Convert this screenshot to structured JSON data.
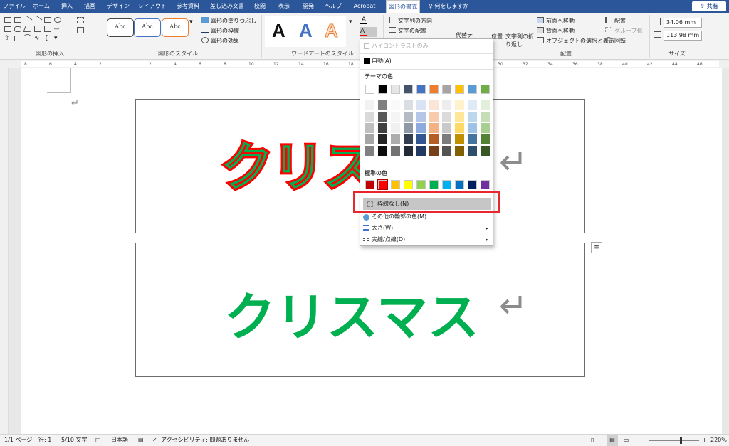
{
  "tabs": [
    "ファイル",
    "ホーム",
    "挿入",
    "描画",
    "デザイン",
    "レイアウト",
    "参考資料",
    "差し込み文書",
    "校閲",
    "表示",
    "開発",
    "ヘルプ",
    "Acrobat",
    "図形の書式",
    "何をしますか"
  ],
  "share_label": "共有",
  "groups": {
    "insert_shapes": "図形の挿入",
    "shape_styles": "図形のスタイル",
    "wordart_styles": "ワードアートのスタイル",
    "arrange": "配置",
    "size": "サイズ"
  },
  "shape_style_samples": [
    "Abc",
    "Abc",
    "Abc"
  ],
  "shape_fill": "図形の塗りつぶし",
  "shape_outline": "図形の枠線",
  "shape_effects": "図形の効果",
  "wordart_samples": [
    "A",
    "A",
    "A"
  ],
  "text_direction": "文字列の方向",
  "text_align": "文字の配置",
  "alt_text": "代替テ",
  "position": "位置",
  "wrap_text": "文字列の折り返し",
  "bring_forward": "前面へ移動",
  "send_backward": "背面へ移動",
  "selection_pane": "オブジェクトの選択と表示",
  "align": "配置",
  "group": "グループ化",
  "rotate": "回転",
  "height_value": "34.06 mm",
  "width_value": "113.98 mm",
  "ruler_numbers": [
    "8",
    "6",
    "4",
    "2",
    "",
    "2",
    "4",
    "6",
    "8",
    "10",
    "12",
    "14",
    "16",
    "18",
    "20",
    "22",
    "24",
    "26",
    "28",
    "30",
    "32",
    "34",
    "36",
    "38",
    "40",
    "42",
    "44",
    "46"
  ],
  "doc": {
    "text1": "クリスマス",
    "text2": "クリスマス"
  },
  "dropdown": {
    "high_contrast": "ハイコントラストのみ",
    "auto": "自動(A)",
    "theme_colors": "テーマの色",
    "standard_colors": "標準の色",
    "no_outline": "枠線なし(N)",
    "more_colors": "その他の輪郭の色(M)...",
    "weight": "太さ(W)",
    "dashes": "実線/点線(D)",
    "theme_swatches": [
      "#ffffff",
      "#000000",
      "#e7e6e6",
      "#44546a",
      "#4472c4",
      "#ed7d31",
      "#a5a5a5",
      "#ffc000",
      "#5b9bd5",
      "#70ad47"
    ],
    "standard_swatches": [
      "#c00000",
      "#ff0000",
      "#ffc000",
      "#ffff00",
      "#92d050",
      "#00b050",
      "#00b0f0",
      "#0070c0",
      "#002060",
      "#7030a0"
    ]
  },
  "status": {
    "page": "1/1 ページ",
    "line": "行: 1",
    "words": "5/10 文字",
    "lang": "日本語",
    "accessibility": "アクセシビリティ: 問題ありません",
    "zoom": "220%"
  },
  "colors": {
    "accent": "#2b579a",
    "red": "#ff0000",
    "green": "#00b050",
    "highlight": "#e8262d"
  }
}
